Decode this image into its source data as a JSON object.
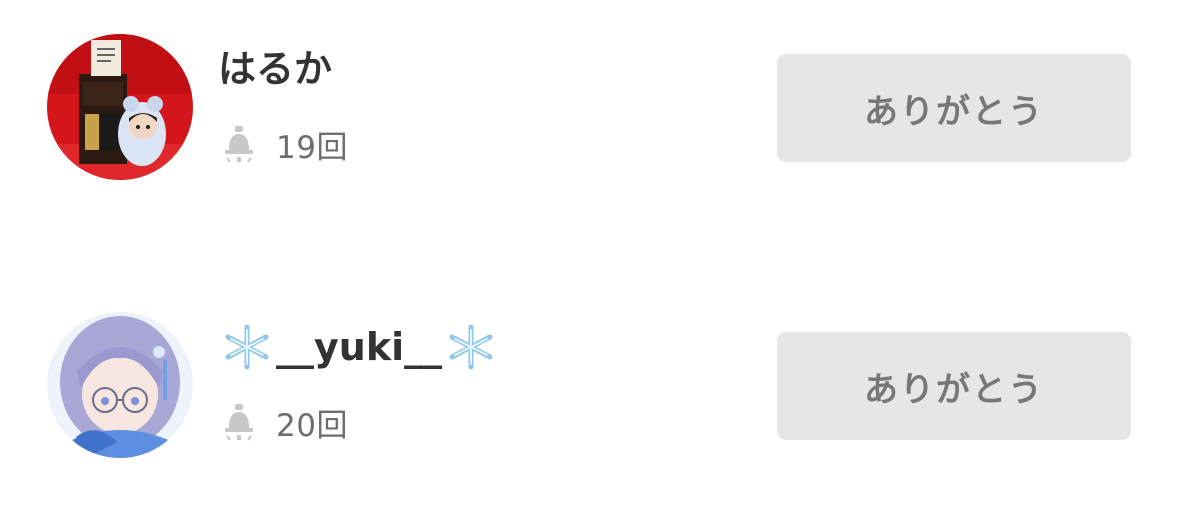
{
  "users": [
    {
      "name": "はるか",
      "count": "19回",
      "thanks_label": "ありがとう",
      "icon": "bell-icon"
    },
    {
      "name_main": "__yuki__",
      "name_decor": "❄️",
      "count": "20回",
      "thanks_label": "ありがとう",
      "icon": "bell-icon"
    }
  ],
  "colors": {
    "button_bg": "#e6e6e6",
    "button_text": "#777777",
    "name_text": "#333333",
    "count_text": "#6e6e6e",
    "icon": "#c8c8c8"
  }
}
